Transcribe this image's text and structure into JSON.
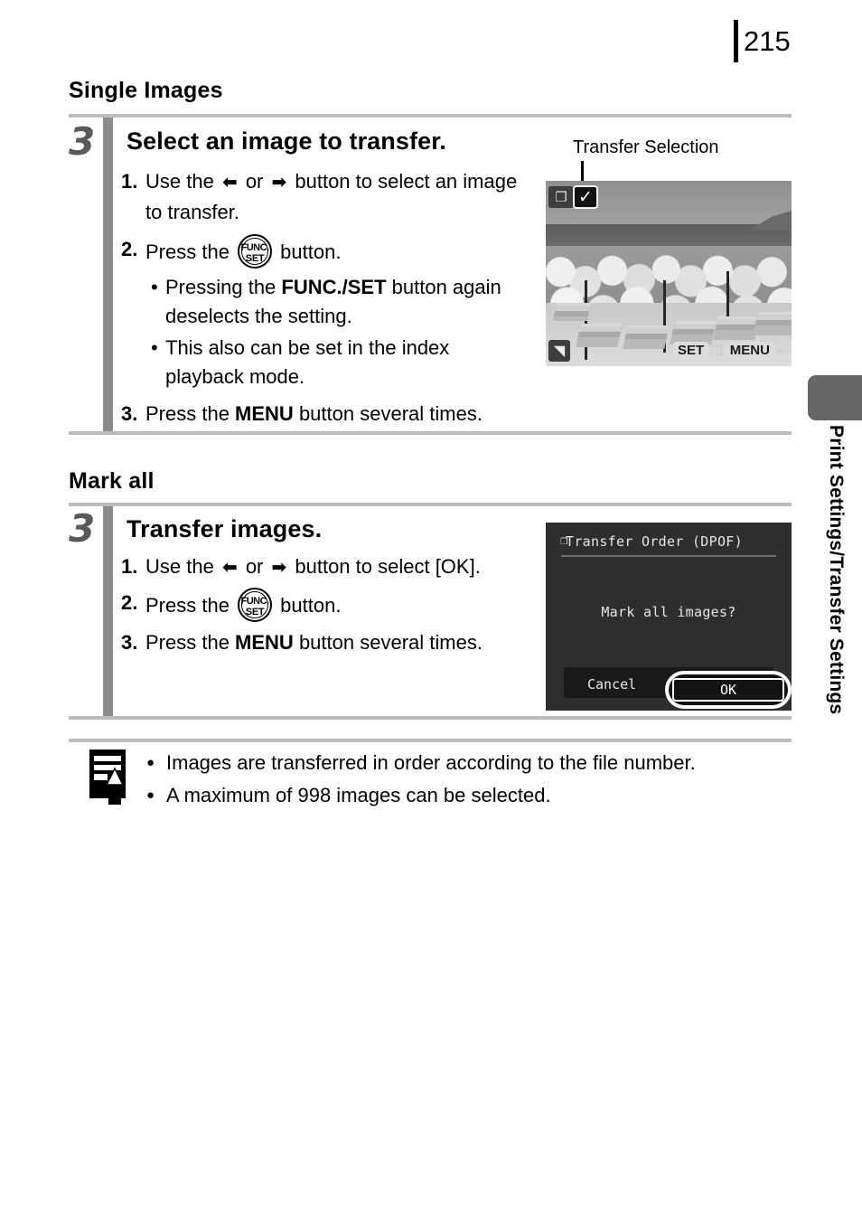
{
  "page": {
    "number": "215",
    "side_tab_label": "Print Settings/Transfer Settings"
  },
  "sections": [
    {
      "heading": "Single Images",
      "step_number": "3",
      "step_title": "Select an image to transfer.",
      "items": [
        {
          "num": "1.",
          "pre": "Use the ",
          "arrow_left": "←",
          "mid": " or ",
          "arrow_right": "→",
          "post": " button to select an image to transfer."
        },
        {
          "num": "2.",
          "pre": "Press the ",
          "icon": "func-set-button",
          "post": " button."
        },
        {
          "num": "3.",
          "pre": "Press the ",
          "bold": "MENU",
          "post": " button several times."
        }
      ],
      "bullets": [
        {
          "pre": "Pressing the ",
          "bold": "FUNC./SET",
          "post": " button again deselects the setting."
        },
        {
          "pre": "This also can be set in the index playback mode.",
          "bold": "",
          "post": ""
        }
      ],
      "screen": {
        "callout": "Transfer Selection",
        "checkmark": "✓",
        "transfer_icon": "❐",
        "quality_icon": "◥",
        "buttons": [
          {
            "type": "key",
            "label": "SET"
          },
          {
            "type": "icon",
            "label": "❐"
          },
          {
            "type": "key",
            "label": "MENU"
          },
          {
            "type": "icon",
            "label": "↩"
          }
        ]
      }
    },
    {
      "heading": "Mark all",
      "step_number": "3",
      "step_title": "Transfer images.",
      "items": [
        {
          "num": "1.",
          "pre": "Use the ",
          "arrow_left": "←",
          "mid": " or ",
          "arrow_right": "→",
          "post": " button to select [OK]."
        },
        {
          "num": "2.",
          "pre": "Press the ",
          "icon": "func-set-button",
          "post": " button."
        },
        {
          "num": "3.",
          "pre": "Press the ",
          "bold": "MENU",
          "post": " button several times."
        }
      ],
      "dialog": {
        "title": "Transfer Order (DPOF)",
        "title_icon": "❐",
        "message": "Mark all images?",
        "cancel_label": "Cancel",
        "ok_label": "OK"
      }
    }
  ],
  "func_set_icon": {
    "top": "FUNC.",
    "bottom": "SET"
  },
  "notes": {
    "icon": "note-pencil-icon",
    "bullet": "●",
    "lines": [
      "Images are transferred in order according to the file number.",
      "A maximum of 998 images can be selected."
    ]
  }
}
